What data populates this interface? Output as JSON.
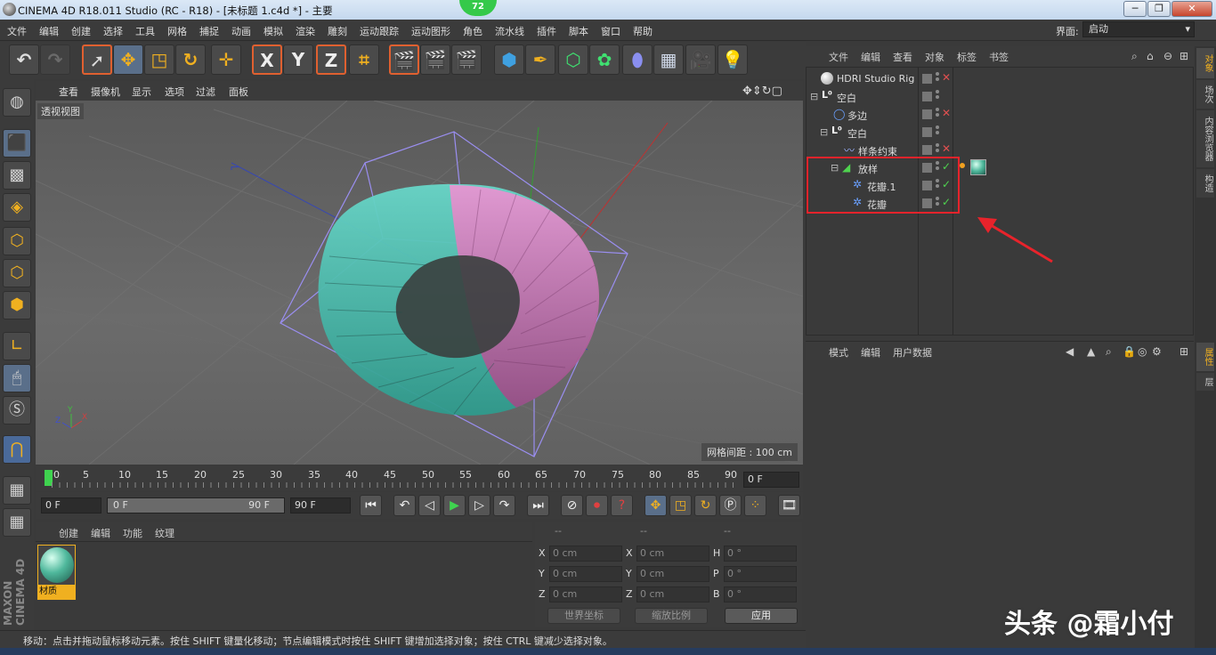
{
  "window": {
    "title": "CINEMA 4D R18.011 Studio (RC - R18) - [未标题 1.c4d *] - 主要",
    "badge": "72",
    "buttons": {
      "minimize": "─",
      "restore": "❐",
      "close": "✕"
    }
  },
  "menubar": {
    "items": [
      "文件",
      "编辑",
      "创建",
      "选择",
      "工具",
      "网格",
      "捕捉",
      "动画",
      "模拟",
      "渲染",
      "雕刻",
      "运动跟踪",
      "运动图形",
      "角色",
      "流水线",
      "插件",
      "脚本",
      "窗口",
      "帮助"
    ],
    "layout_label": "界面:",
    "layout_value": "启动"
  },
  "toolbar": {
    "x_label": "X",
    "y_label": "Y",
    "z_label": "Z"
  },
  "viewport": {
    "menu": [
      "查看",
      "摄像机",
      "显示",
      "选项",
      "过滤",
      "面板"
    ],
    "view_label": "透视视图",
    "grid_spacing": "网格间距 : 100 cm"
  },
  "timeline": {
    "ticks": [
      "0",
      "5",
      "10",
      "15",
      "20",
      "25",
      "30",
      "35",
      "40",
      "45",
      "50",
      "55",
      "60",
      "65",
      "70",
      "75",
      "80",
      "85",
      "90"
    ],
    "current_frame": "0 F"
  },
  "transport": {
    "start_field": "0 F",
    "range_start": "0 F",
    "range_end": "90 F",
    "end_field": "90 F"
  },
  "material_panel": {
    "menu": [
      "创建",
      "编辑",
      "功能",
      "纹理"
    ],
    "material_name": "材质"
  },
  "coords": {
    "headers": [
      "--",
      "--",
      "--"
    ],
    "rows": [
      {
        "l1": "X",
        "v1": "0 cm",
        "l2": "X",
        "v2": "0 cm",
        "l3": "H",
        "v3": "0 °"
      },
      {
        "l1": "Y",
        "v1": "0 cm",
        "l2": "Y",
        "v2": "0 cm",
        "l3": "P",
        "v3": "0 °"
      },
      {
        "l1": "Z",
        "v1": "0 cm",
        "l2": "Z",
        "v2": "0 cm",
        "l3": "B",
        "v3": "0 °"
      }
    ],
    "world_coords": "世界坐标",
    "scale_ratio": "缩放比例",
    "apply": "应用"
  },
  "status": {
    "text": "移动：点击并拖动鼠标移动元素。按住 SHIFT 键量化移动；节点编辑模式时按住 SHIFT 键增加选择对象；按住 CTRL 键减少选择对象。"
  },
  "object_manager": {
    "menu": [
      "文件",
      "编辑",
      "查看",
      "对象",
      "标签",
      "书签"
    ],
    "objects": [
      {
        "name": "HDRI Studio Rig",
        "indent": 0,
        "mark": "✕",
        "mark_color": "#e05050",
        "icon": "sphere-icon"
      },
      {
        "name": "空白",
        "indent": 0,
        "mark": "",
        "mark_color": "",
        "icon": "null-icon"
      },
      {
        "name": "多边",
        "indent": 1,
        "mark": "✕",
        "mark_color": "#e05050",
        "icon": "circle-spline-icon"
      },
      {
        "name": "空白",
        "indent": 1,
        "mark": "",
        "mark_color": "",
        "icon": "null-icon"
      },
      {
        "name": "样条约束",
        "indent": 2,
        "mark": "✕",
        "mark_color": "#e05050",
        "icon": "spline-wrap-icon"
      },
      {
        "name": "放样",
        "indent": 2,
        "mark": "✓",
        "mark_color": "#4fd34f",
        "icon": "loft-icon"
      },
      {
        "name": "花瓣.1",
        "indent": 3,
        "mark": "✓",
        "mark_color": "#4fd34f",
        "icon": "flower-spline-icon"
      },
      {
        "name": "花瓣",
        "indent": 3,
        "mark": "✓",
        "mark_color": "#4fd34f",
        "icon": "flower-spline-icon"
      }
    ]
  },
  "attributes": {
    "menu": [
      "模式",
      "编辑",
      "用户数据"
    ]
  },
  "side_tabs": [
    "对象",
    "场次",
    "内容浏览器",
    "构造",
    "属性",
    "层"
  ],
  "left_logo": "MAXON CINEMA 4D",
  "watermark": "头条 @霜小付"
}
